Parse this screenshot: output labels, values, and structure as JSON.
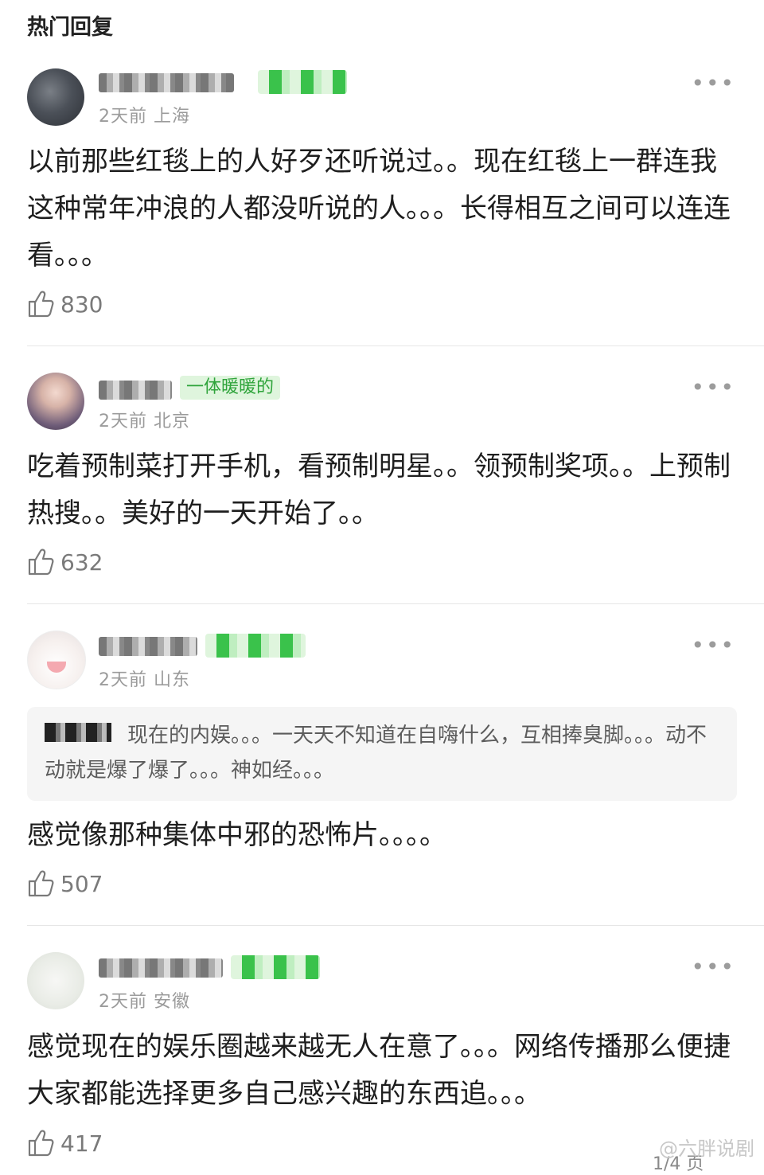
{
  "section_title": "热门回复",
  "comments": [
    {
      "badge": "",
      "meta": "2天前 上海",
      "text": "以前那些红毯上的人好歹还听说过。。现在红毯上一群连我这种常年冲浪的人都没听说的人。。。长得相互之间可以连连看。。。",
      "likes": "830"
    },
    {
      "badge": "一体暖暖的",
      "meta": "2天前 北京",
      "text": "吃着预制菜打开手机，看预制明星。。领预制奖项。。上预制热搜。。美好的一天开始了。。",
      "likes": "632"
    },
    {
      "badge": "",
      "meta": "2天前 山东",
      "quote": "现在的内娱。。。一天天不知道在自嗨什么，互相捧臭脚。。。动不动就是爆了爆了。。。神如经。。。",
      "text": "感觉像那种集体中邪的恐怖片。。。。",
      "likes": "507"
    },
    {
      "badge": "",
      "meta": "2天前 安徽",
      "text": "感觉现在的娱乐圈越来越无人在意了。。。网络传播那么便捷大家都能选择更多自己感兴趣的东西追。。。",
      "likes": "417"
    }
  ],
  "more_label": "•••",
  "watermark": "@六胖说剧",
  "page_indicator": "1/4 页",
  "colors": {
    "badge_green": "#2fa43b",
    "badge_bg": "#dff5dd",
    "meta_gray": "#9b9b9b"
  }
}
